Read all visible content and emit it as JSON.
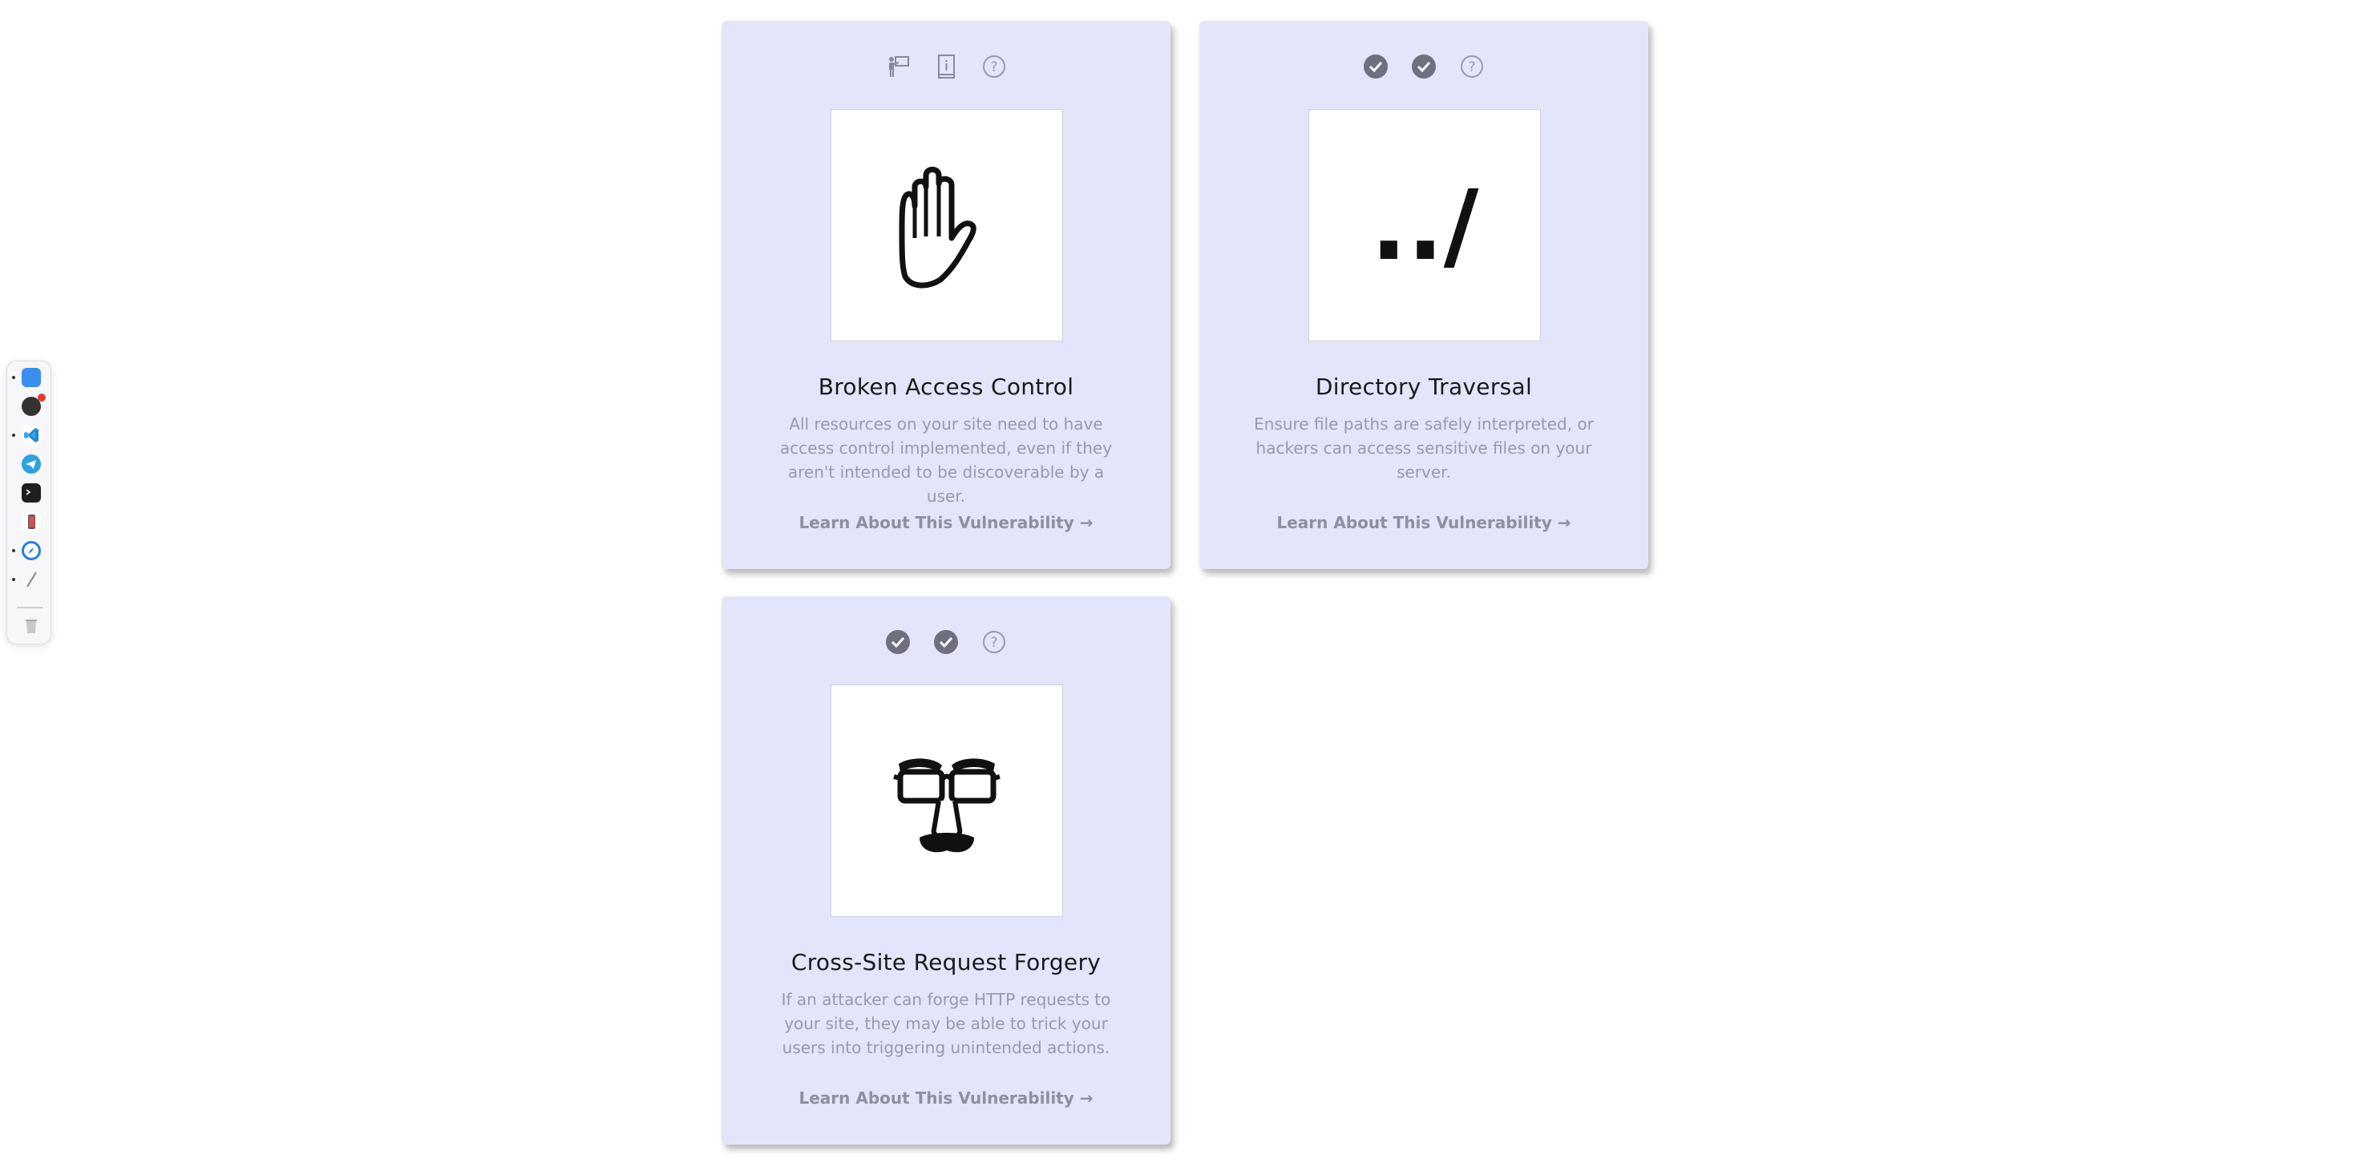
{
  "dock": {
    "apps": [
      {
        "name": "finder",
        "color": "#3a8ef0",
        "running": true
      },
      {
        "name": "chatgpt",
        "color": "#333333",
        "running": false,
        "badge": true
      },
      {
        "name": "vscode",
        "color": "#1f8ad2",
        "running": true
      },
      {
        "name": "telegram",
        "color": "#2aa3df",
        "running": false
      },
      {
        "name": "terminal",
        "color": "#1e1e1e",
        "running": false
      },
      {
        "name": "iphone-mirroring",
        "color": "#d55050",
        "running": false
      },
      {
        "name": "safari",
        "color": "#2a7de1",
        "running": true
      },
      {
        "name": "script-editor",
        "color": "#9a9a9a",
        "running": true
      },
      {
        "name": "trash",
        "color": "#bdbdbd",
        "running": false
      }
    ]
  },
  "cards": [
    {
      "title": "Broken Access Control",
      "description": "All resources on your site need to have access control implemented, even if they aren't intended to be discoverable by a user.",
      "link": "Learn About This Vulnerability →",
      "icons": [
        "presentation-icon",
        "book-icon",
        "question-icon"
      ],
      "illustration": "hand"
    },
    {
      "title": "Directory Traversal",
      "description": "Ensure file paths are safely interpreted, or hackers can access sensitive files on your server.",
      "link": "Learn About This Vulnerability →",
      "icons": [
        "check-icon",
        "check-icon",
        "question-icon"
      ],
      "illustration": "dot-dot-slash",
      "illustration_text": "../"
    },
    {
      "title": "Cross-Site Request Forgery",
      "description": "If an attacker can forge HTTP requests to your site, they may be able to trick your users into triggering unintended actions.",
      "link": "Learn About This Vulnerability →",
      "icons": [
        "check-icon",
        "check-icon",
        "question-icon"
      ],
      "illustration": "disguise-glasses"
    }
  ],
  "colors": {
    "card_bg": "#e4e4fa",
    "icon_gray": "#6f6f80",
    "title": "#1a1a1a",
    "muted_text": "#9a9aaa"
  }
}
